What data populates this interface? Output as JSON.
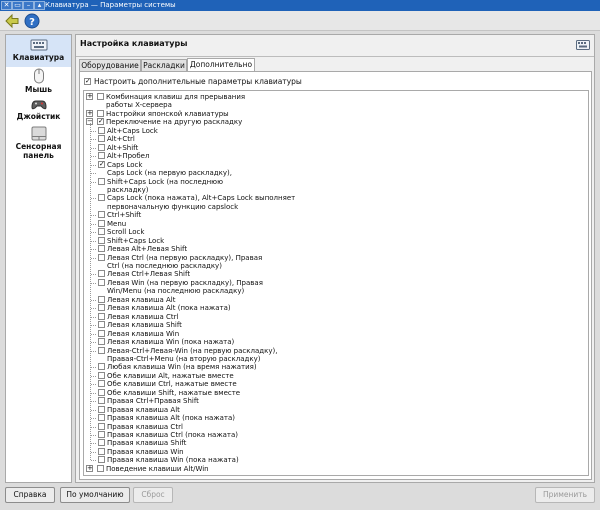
{
  "window": {
    "title": "Клавиатура — Параметры системы",
    "controls": [
      "✕",
      "▭",
      "–",
      "▴"
    ]
  },
  "toolbar": {
    "back_icon": "back-arrow-icon",
    "help_icon": "help-icon"
  },
  "sidebar": {
    "items": [
      {
        "label": "Клавиатура",
        "icon": "keyboard-icon",
        "selected": true
      },
      {
        "label": "Мышь",
        "icon": "mouse-icon",
        "selected": false
      },
      {
        "label": "Джойстик",
        "icon": "joystick-icon",
        "selected": false
      },
      {
        "label": "Сенсорная панель",
        "icon": "touchpad-icon",
        "selected": false
      }
    ]
  },
  "panel": {
    "title": "Настройка клавиатуры",
    "tabs": [
      {
        "label": "Оборудование"
      },
      {
        "label": "Раскладки"
      },
      {
        "label": "Дополнительно",
        "selected": true
      }
    ],
    "configure_label": "Настроить дополнительные параметры клавиатуры",
    "configure_checked": true
  },
  "tree": [
    {
      "label": "Комбинация клавиш для прерывания работы X-сервера",
      "lines": [
        "Комбинация клавиш для прерывания",
        "работы X-сервера"
      ],
      "level": 0,
      "expander": "+",
      "checked": false
    },
    {
      "label": "Настройки японской клавиатуры",
      "lines": [
        "Настройки японской клавиатуры"
      ],
      "level": 0,
      "expander": "+",
      "checked": false
    },
    {
      "label": "Переключение на другую раскладку",
      "lines": [
        "Переключение на другую раскладку"
      ],
      "level": 0,
      "expander": "−",
      "checked": true
    },
    {
      "lines": [
        "Alt+Caps Lock"
      ],
      "level": 1,
      "checked": false
    },
    {
      "lines": [
        "Alt+Ctrl"
      ],
      "level": 1,
      "checked": false
    },
    {
      "lines": [
        "Alt+Shift"
      ],
      "level": 1,
      "checked": false
    },
    {
      "lines": [
        "Alt+Пробел"
      ],
      "level": 1,
      "checked": false
    },
    {
      "lines": [
        "Caps Lock"
      ],
      "level": 1,
      "checked": true
    },
    {
      "lines": [
        "Caps Lock (на первую раскладку),"
      ],
      "level": 1,
      "checked": null
    },
    {
      "lines": [
        "Shift+Caps Lock (на последнюю",
        "раскладку)"
      ],
      "level": 1,
      "checked": false
    },
    {
      "lines": [
        "Caps Lock (пока нажата), Alt+Caps Lock выполняет",
        "первоначальную функцию capslock"
      ],
      "level": 1,
      "checked": false
    },
    {
      "lines": [
        "Ctrl+Shift"
      ],
      "level": 1,
      "checked": false
    },
    {
      "lines": [
        "Menu"
      ],
      "level": 1,
      "checked": false
    },
    {
      "lines": [
        "Scroll Lock"
      ],
      "level": 1,
      "checked": false
    },
    {
      "lines": [
        "Shift+Caps Lock"
      ],
      "level": 1,
      "checked": false
    },
    {
      "lines": [
        "Левая Alt+Левая Shift"
      ],
      "level": 1,
      "checked": false
    },
    {
      "lines": [
        "Левая Ctrl (на первую раскладку), Правая",
        "Ctrl (на последнюю раскладку)"
      ],
      "level": 1,
      "checked": false
    },
    {
      "lines": [
        "Левая Ctrl+Левая Shift"
      ],
      "level": 1,
      "checked": false
    },
    {
      "lines": [
        "Левая Win (на первую раскладку), Правая",
        "Win/Menu (на последнюю раскладку)"
      ],
      "level": 1,
      "checked": false
    },
    {
      "lines": [
        "Левая клавиша Alt"
      ],
      "level": 1,
      "checked": false
    },
    {
      "lines": [
        "Левая клавиша Alt (пока нажата)"
      ],
      "level": 1,
      "checked": false
    },
    {
      "lines": [
        "Левая клавиша Ctrl"
      ],
      "level": 1,
      "checked": false
    },
    {
      "lines": [
        "Левая клавиша Shift"
      ],
      "level": 1,
      "checked": false
    },
    {
      "lines": [
        "Левая клавиша Win"
      ],
      "level": 1,
      "checked": false
    },
    {
      "lines": [
        "Левая клавиша Win (пока нажата)"
      ],
      "level": 1,
      "checked": false
    },
    {
      "lines": [
        "Левая-Ctrl+Левая-Win (на первую раскладку),",
        "Правая-Ctrl+Menu (на вторую раскладку)"
      ],
      "level": 1,
      "checked": false
    },
    {
      "lines": [
        "Любая клавиша Win (на время нажатия)"
      ],
      "level": 1,
      "checked": false
    },
    {
      "lines": [
        "Обе клавиши Alt, нажатые вместе"
      ],
      "level": 1,
      "checked": false
    },
    {
      "lines": [
        "Обе клавиши Ctrl, нажатые вместе"
      ],
      "level": 1,
      "checked": false
    },
    {
      "lines": [
        "Обе клавиши Shift, нажатые вместе"
      ],
      "level": 1,
      "checked": false
    },
    {
      "lines": [
        "Правая Ctrl+Правая Shift"
      ],
      "level": 1,
      "checked": false
    },
    {
      "lines": [
        "Правая клавиша Alt"
      ],
      "level": 1,
      "checked": false
    },
    {
      "lines": [
        "Правая клавиша Alt (пока нажата)"
      ],
      "level": 1,
      "checked": false
    },
    {
      "lines": [
        "Правая клавиша Ctrl"
      ],
      "level": 1,
      "checked": false
    },
    {
      "lines": [
        "Правая клавиша Ctrl (пока нажата)"
      ],
      "level": 1,
      "checked": false
    },
    {
      "lines": [
        "Правая клавиша Shift"
      ],
      "level": 1,
      "checked": false
    },
    {
      "lines": [
        "Правая клавиша Win"
      ],
      "level": 1,
      "checked": false
    },
    {
      "lines": [
        "Правая клавиша Win (пока нажата)"
      ],
      "level": 1,
      "checked": false
    },
    {
      "lines": [
        "Поведение клавиши Alt/Win"
      ],
      "level": 0,
      "expander": "+",
      "checked": false
    }
  ],
  "buttons": {
    "help": "Справка",
    "defaults": "По умолчанию",
    "reset": "Сброс",
    "apply": "Применить"
  },
  "colors": {
    "titlebar": "#1f62b8",
    "selection": "#d6e4f7"
  }
}
